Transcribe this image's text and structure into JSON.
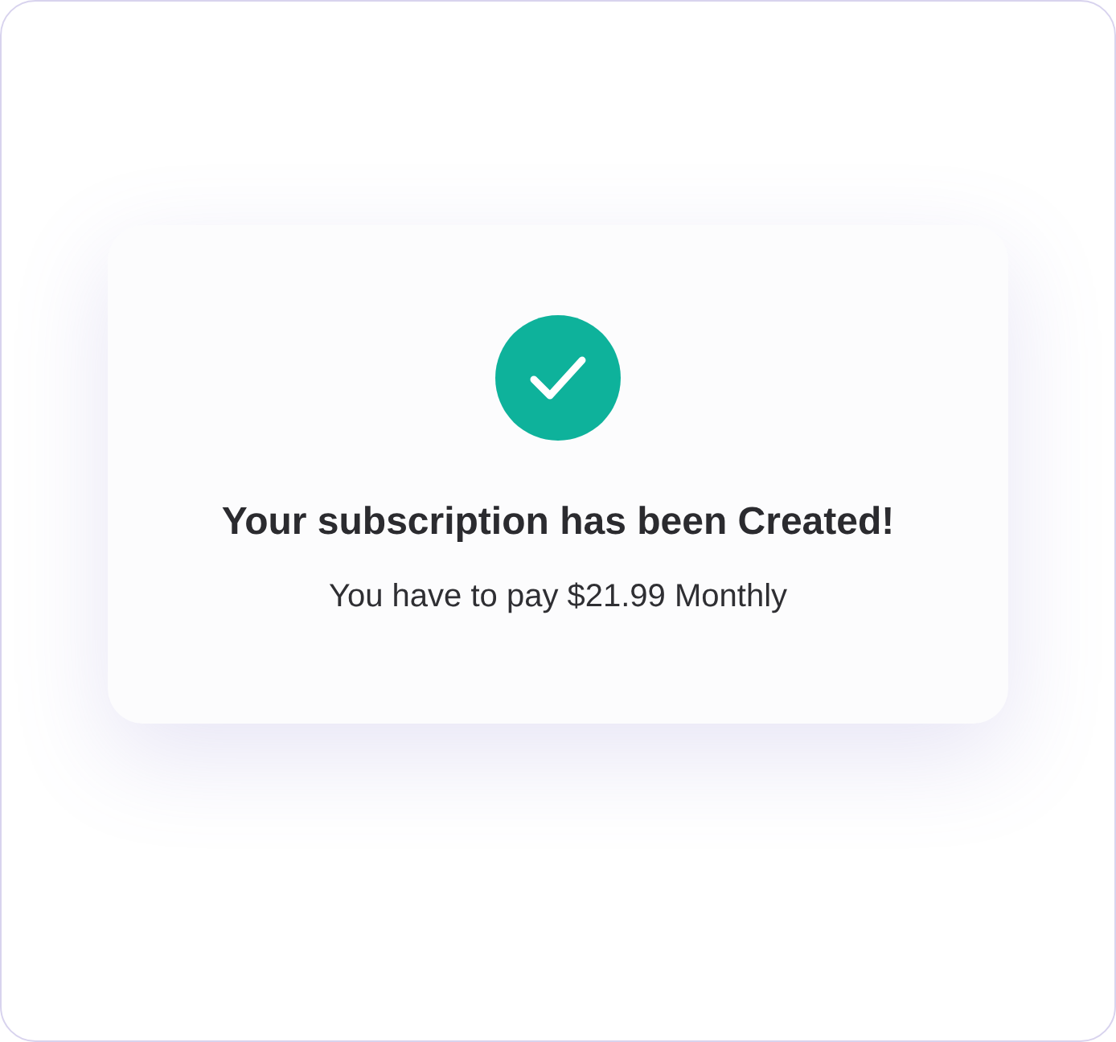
{
  "card": {
    "title": "Your subscription has been Created!",
    "message": "You have to pay $21.99 Monthly"
  }
}
